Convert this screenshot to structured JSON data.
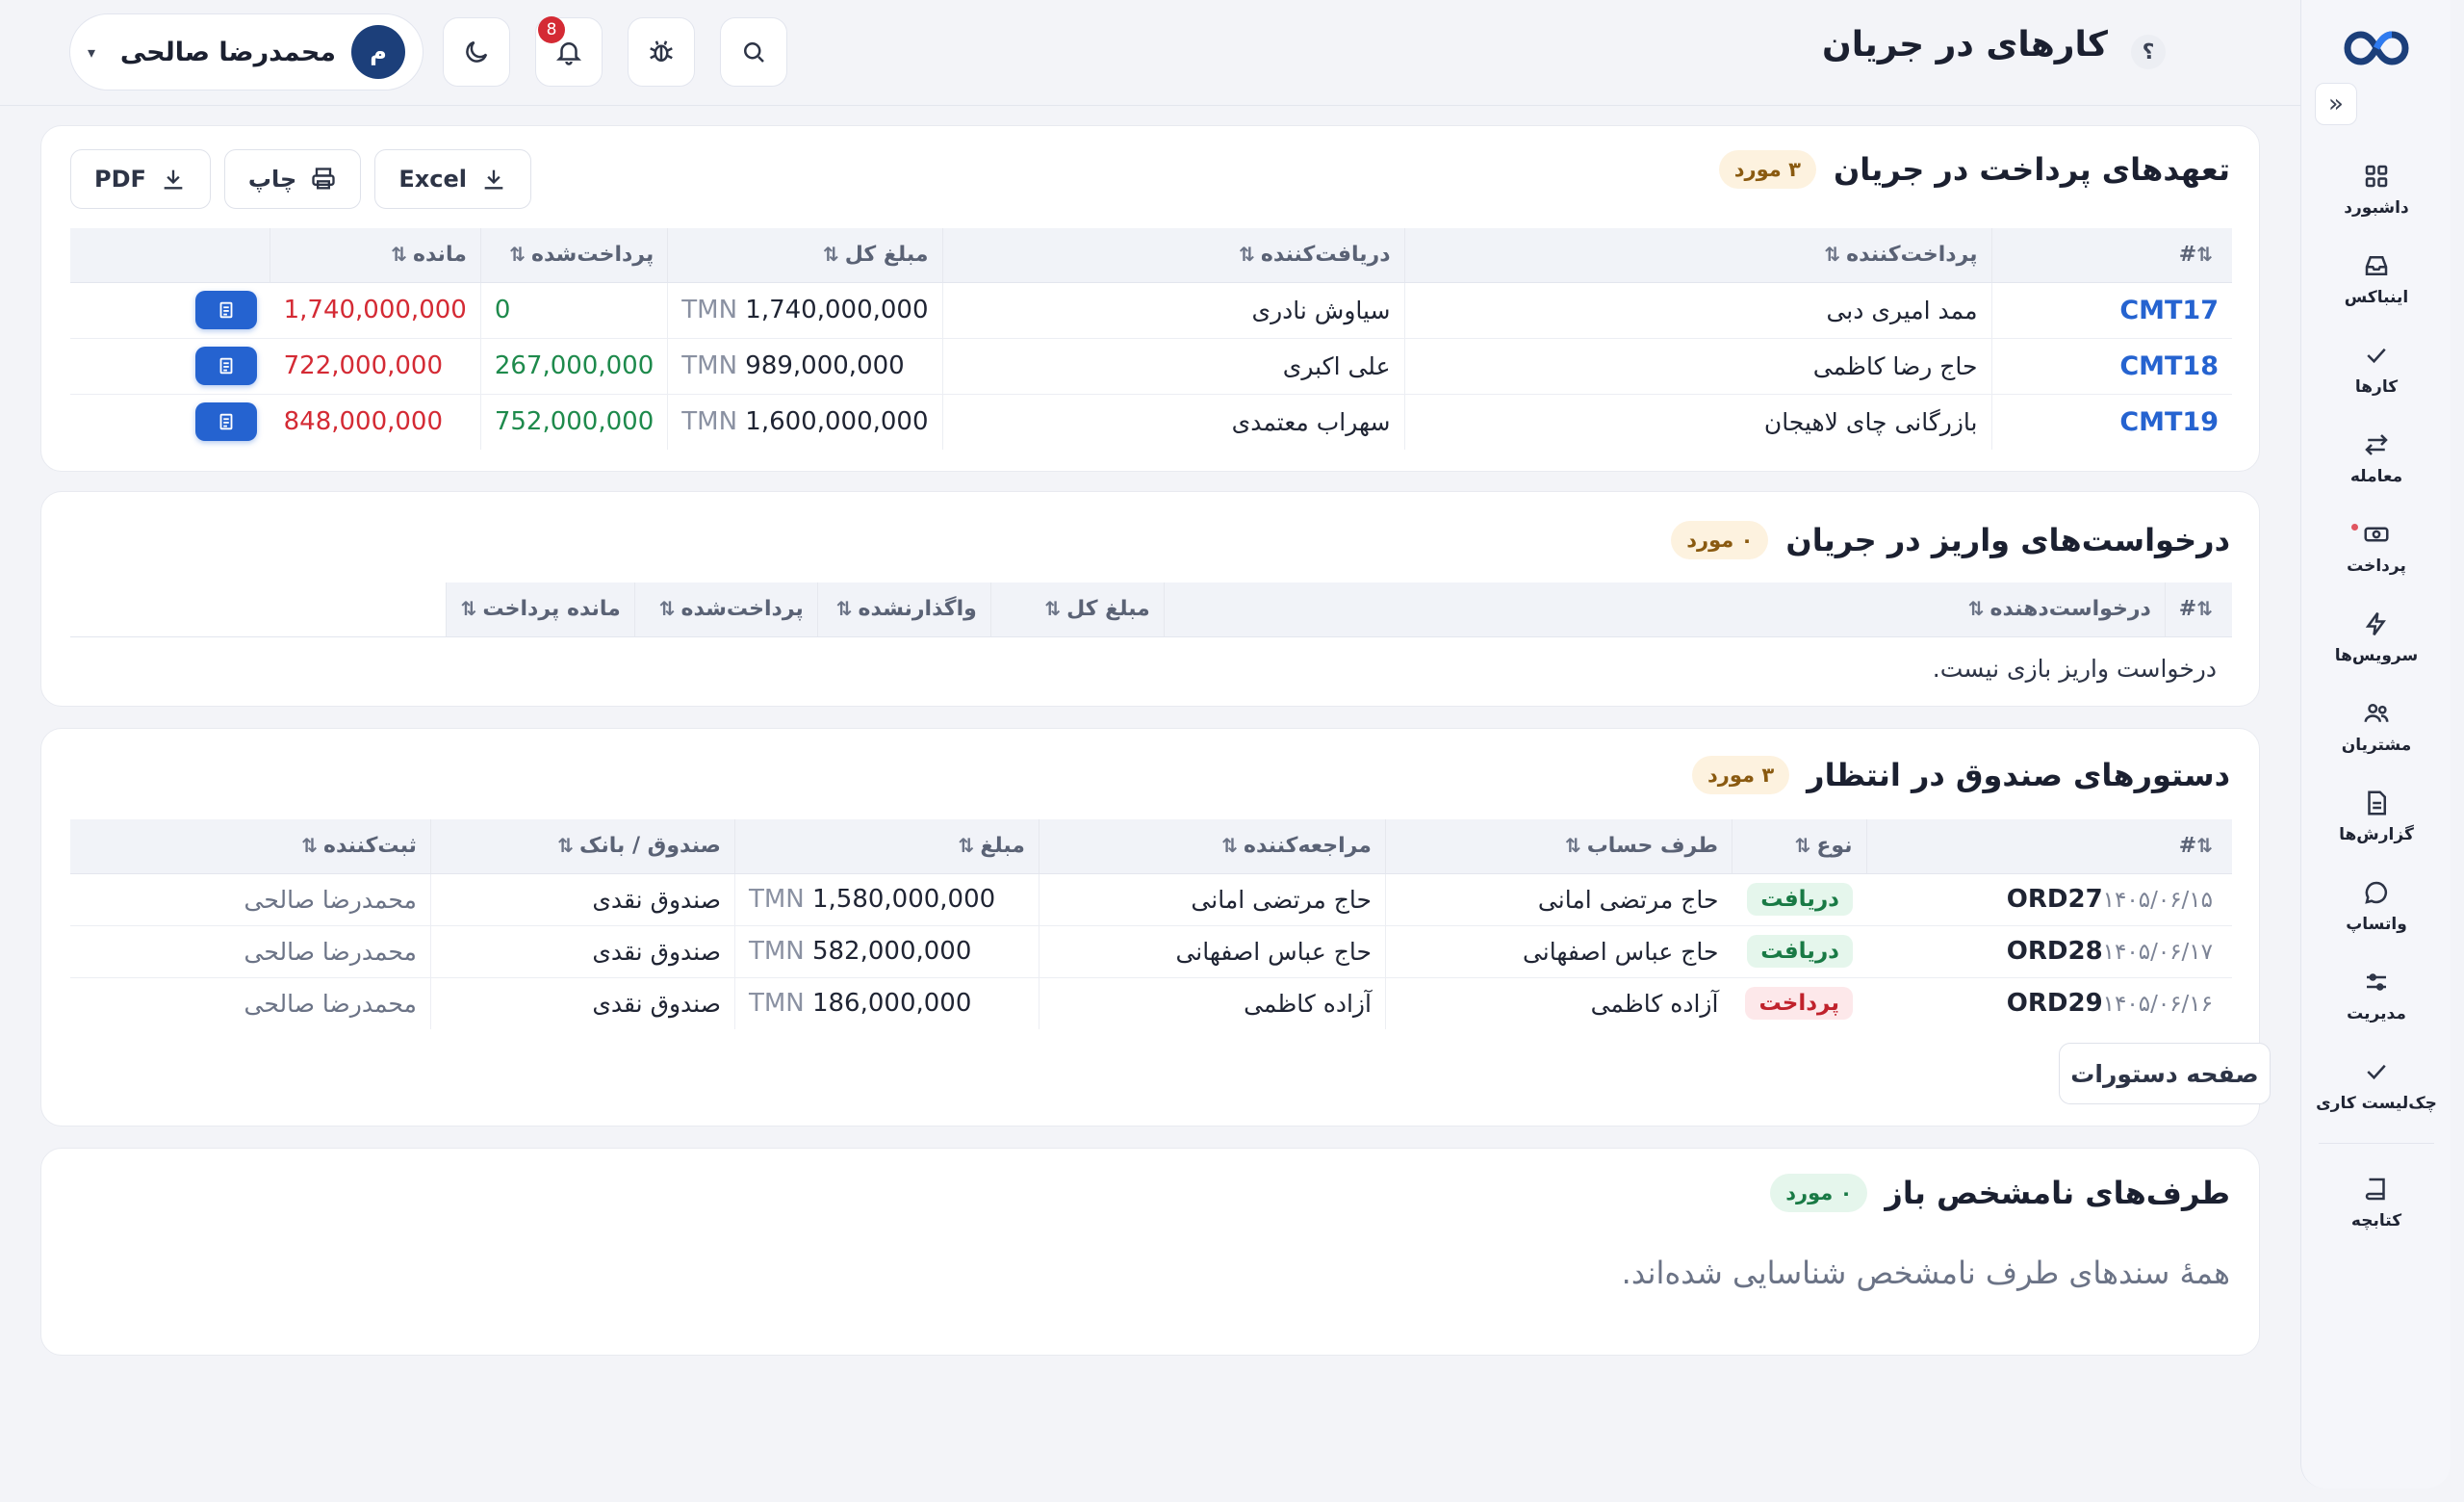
{
  "header": {
    "title": "کارهای در جریان",
    "help": "؟",
    "notifications_count": "8",
    "user": {
      "initial": "م",
      "name": "محمدرضا صالحی",
      "caret": "▾"
    }
  },
  "sidebar": {
    "collapse": "»",
    "items": [
      {
        "label": "داشبورد",
        "icon": "grid-icon"
      },
      {
        "label": "اینباکس",
        "icon": "inbox-icon"
      },
      {
        "label": "کارها",
        "icon": "check-icon"
      },
      {
        "label": "معامله",
        "icon": "swap-icon"
      },
      {
        "label": "پرداخت",
        "icon": "cash-icon"
      },
      {
        "label": "سرویس‌ها",
        "icon": "bolt-icon"
      },
      {
        "label": "مشتریان",
        "icon": "users-icon"
      },
      {
        "label": "گزارش‌ها",
        "icon": "file-icon"
      },
      {
        "label": "واتساپ",
        "icon": "chat-icon"
      },
      {
        "label": "مدیریت",
        "icon": "sliders-icon"
      },
      {
        "label": "چک‌لیست کاری",
        "icon": "check-icon"
      },
      {
        "label": "کتابچه",
        "icon": "book-icon"
      }
    ]
  },
  "commitments": {
    "title": "تعهدهای پرداخت در جریان",
    "count": "۳ مورد",
    "exports": {
      "excel": "Excel",
      "print": "چاپ",
      "pdf": "PDF"
    },
    "columns": [
      "#",
      "پرداخت‌کننده",
      "دریافت‌کننده",
      "مبلغ کل",
      "پرداخت‌شده",
      "مانده"
    ],
    "currency": "TMN",
    "rows": [
      {
        "id": "CMT17",
        "payer": "ممد امیری دبی",
        "payee": "سیاوش نادری",
        "total": "1,740,000,000",
        "paid": "0",
        "remaining": "1,740,000,000"
      },
      {
        "id": "CMT18",
        "payer": "حاج رضا کاظمی",
        "payee": "علی اکبری",
        "total": "989,000,000",
        "paid": "267,000,000",
        "remaining": "722,000,000"
      },
      {
        "id": "CMT19",
        "payer": "بازرگانی چای لاهیجان",
        "payee": "سهراب معتمدی",
        "total": "1,600,000,000",
        "paid": "752,000,000",
        "remaining": "848,000,000"
      }
    ]
  },
  "deposits": {
    "title": "درخواست‌های واریز در جریان",
    "count": "۰ مورد",
    "columns": [
      "#",
      "درخواست‌دهنده",
      "مبلغ کل",
      "واگذارنشده",
      "پرداخت‌شده",
      "مانده پرداخت"
    ],
    "empty": "درخواست واریز بازی نیست."
  },
  "orders": {
    "title": "دستورهای صندوق در انتظار",
    "count": "۳ مورد",
    "columns": [
      "#",
      "نوع",
      "طرف حساب",
      "مراجعه‌کننده",
      "مبلغ",
      "صندوق / بانک",
      "ثبت‌کننده"
    ],
    "currency": "TMN",
    "rows": [
      {
        "date": "۱۴۰۵/۰۶/۱۵",
        "id": "ORD27",
        "type": "دریافت",
        "party": "حاج مرتضی امانی",
        "visitor": "حاج مرتضی امانی",
        "amount": "1,580,000,000",
        "fund": "صندوق نقدی",
        "creator": "محمدرضا صالحی"
      },
      {
        "date": "۱۴۰۵/۰۶/۱۷",
        "id": "ORD28",
        "type": "دریافت",
        "party": "حاج عباس اصفهانی",
        "visitor": "حاج عباس اصفهانی",
        "amount": "582,000,000",
        "fund": "صندوق نقدی",
        "creator": "محمدرضا صالحی"
      },
      {
        "date": "۱۴۰۵/۰۶/۱۶",
        "id": "ORD29",
        "type": "پرداخت",
        "party": "آزاده کاظمی",
        "visitor": "آزاده کاظمی",
        "amount": "186,000,000",
        "fund": "صندوق نقدی",
        "creator": "محمدرضا صالحی"
      }
    ],
    "page_button": "صفحه دستورات"
  },
  "unknown": {
    "title": "طرف‌های نامشخص باز",
    "count": "۰ مورد",
    "message": "همهٔ سندهای طرف نامشخص شناسایی شده‌اند."
  },
  "colors": {
    "accent": "#2563d0",
    "danger": "#d42a34",
    "success": "#1e8a4c",
    "badge_bg": "#fdf2df"
  }
}
